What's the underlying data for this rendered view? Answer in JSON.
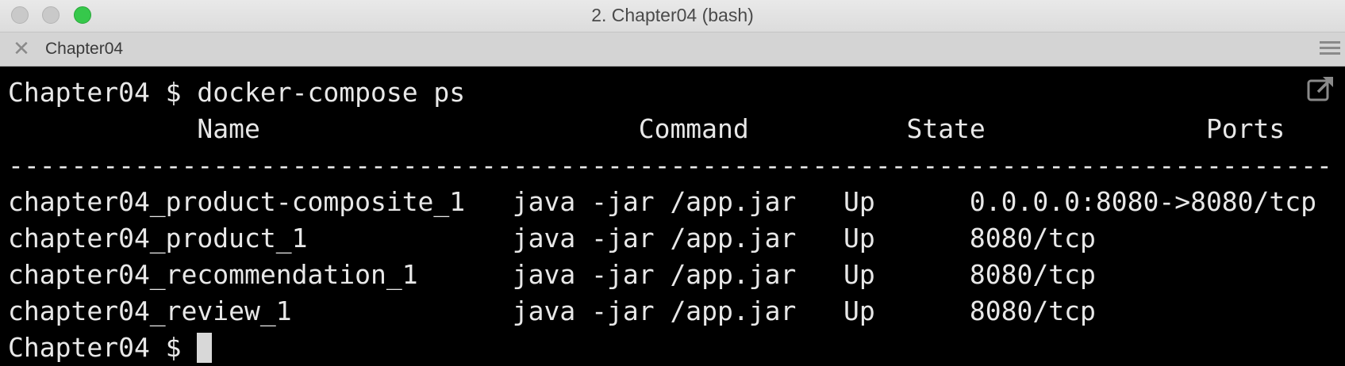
{
  "window": {
    "title": "2. Chapter04 (bash)"
  },
  "tab": {
    "close_glyph": "✕",
    "label": "Chapter04"
  },
  "terminal": {
    "lines": [
      "Chapter04 $ docker-compose ps",
      "            Name                        Command          State              Ports",
      "------------------------------------------------------------------------------------",
      "chapter04_product-composite_1   java -jar /app.jar   Up      0.0.0.0:8080->8080/tcp",
      "chapter04_product_1             java -jar /app.jar   Up      8080/tcp",
      "chapter04_recommendation_1      java -jar /app.jar   Up      8080/tcp",
      "chapter04_review_1              java -jar /app.jar   Up      8080/tcp"
    ],
    "prompt": "Chapter04 $ "
  },
  "icons": {
    "close": "close-icon",
    "menu": "hamburger-menu-icon",
    "popout": "popout-icon"
  },
  "colors": {
    "terminal_bg": "#000000",
    "terminal_fg": "#e8e8e8",
    "maximize_green": "#36c84b"
  }
}
